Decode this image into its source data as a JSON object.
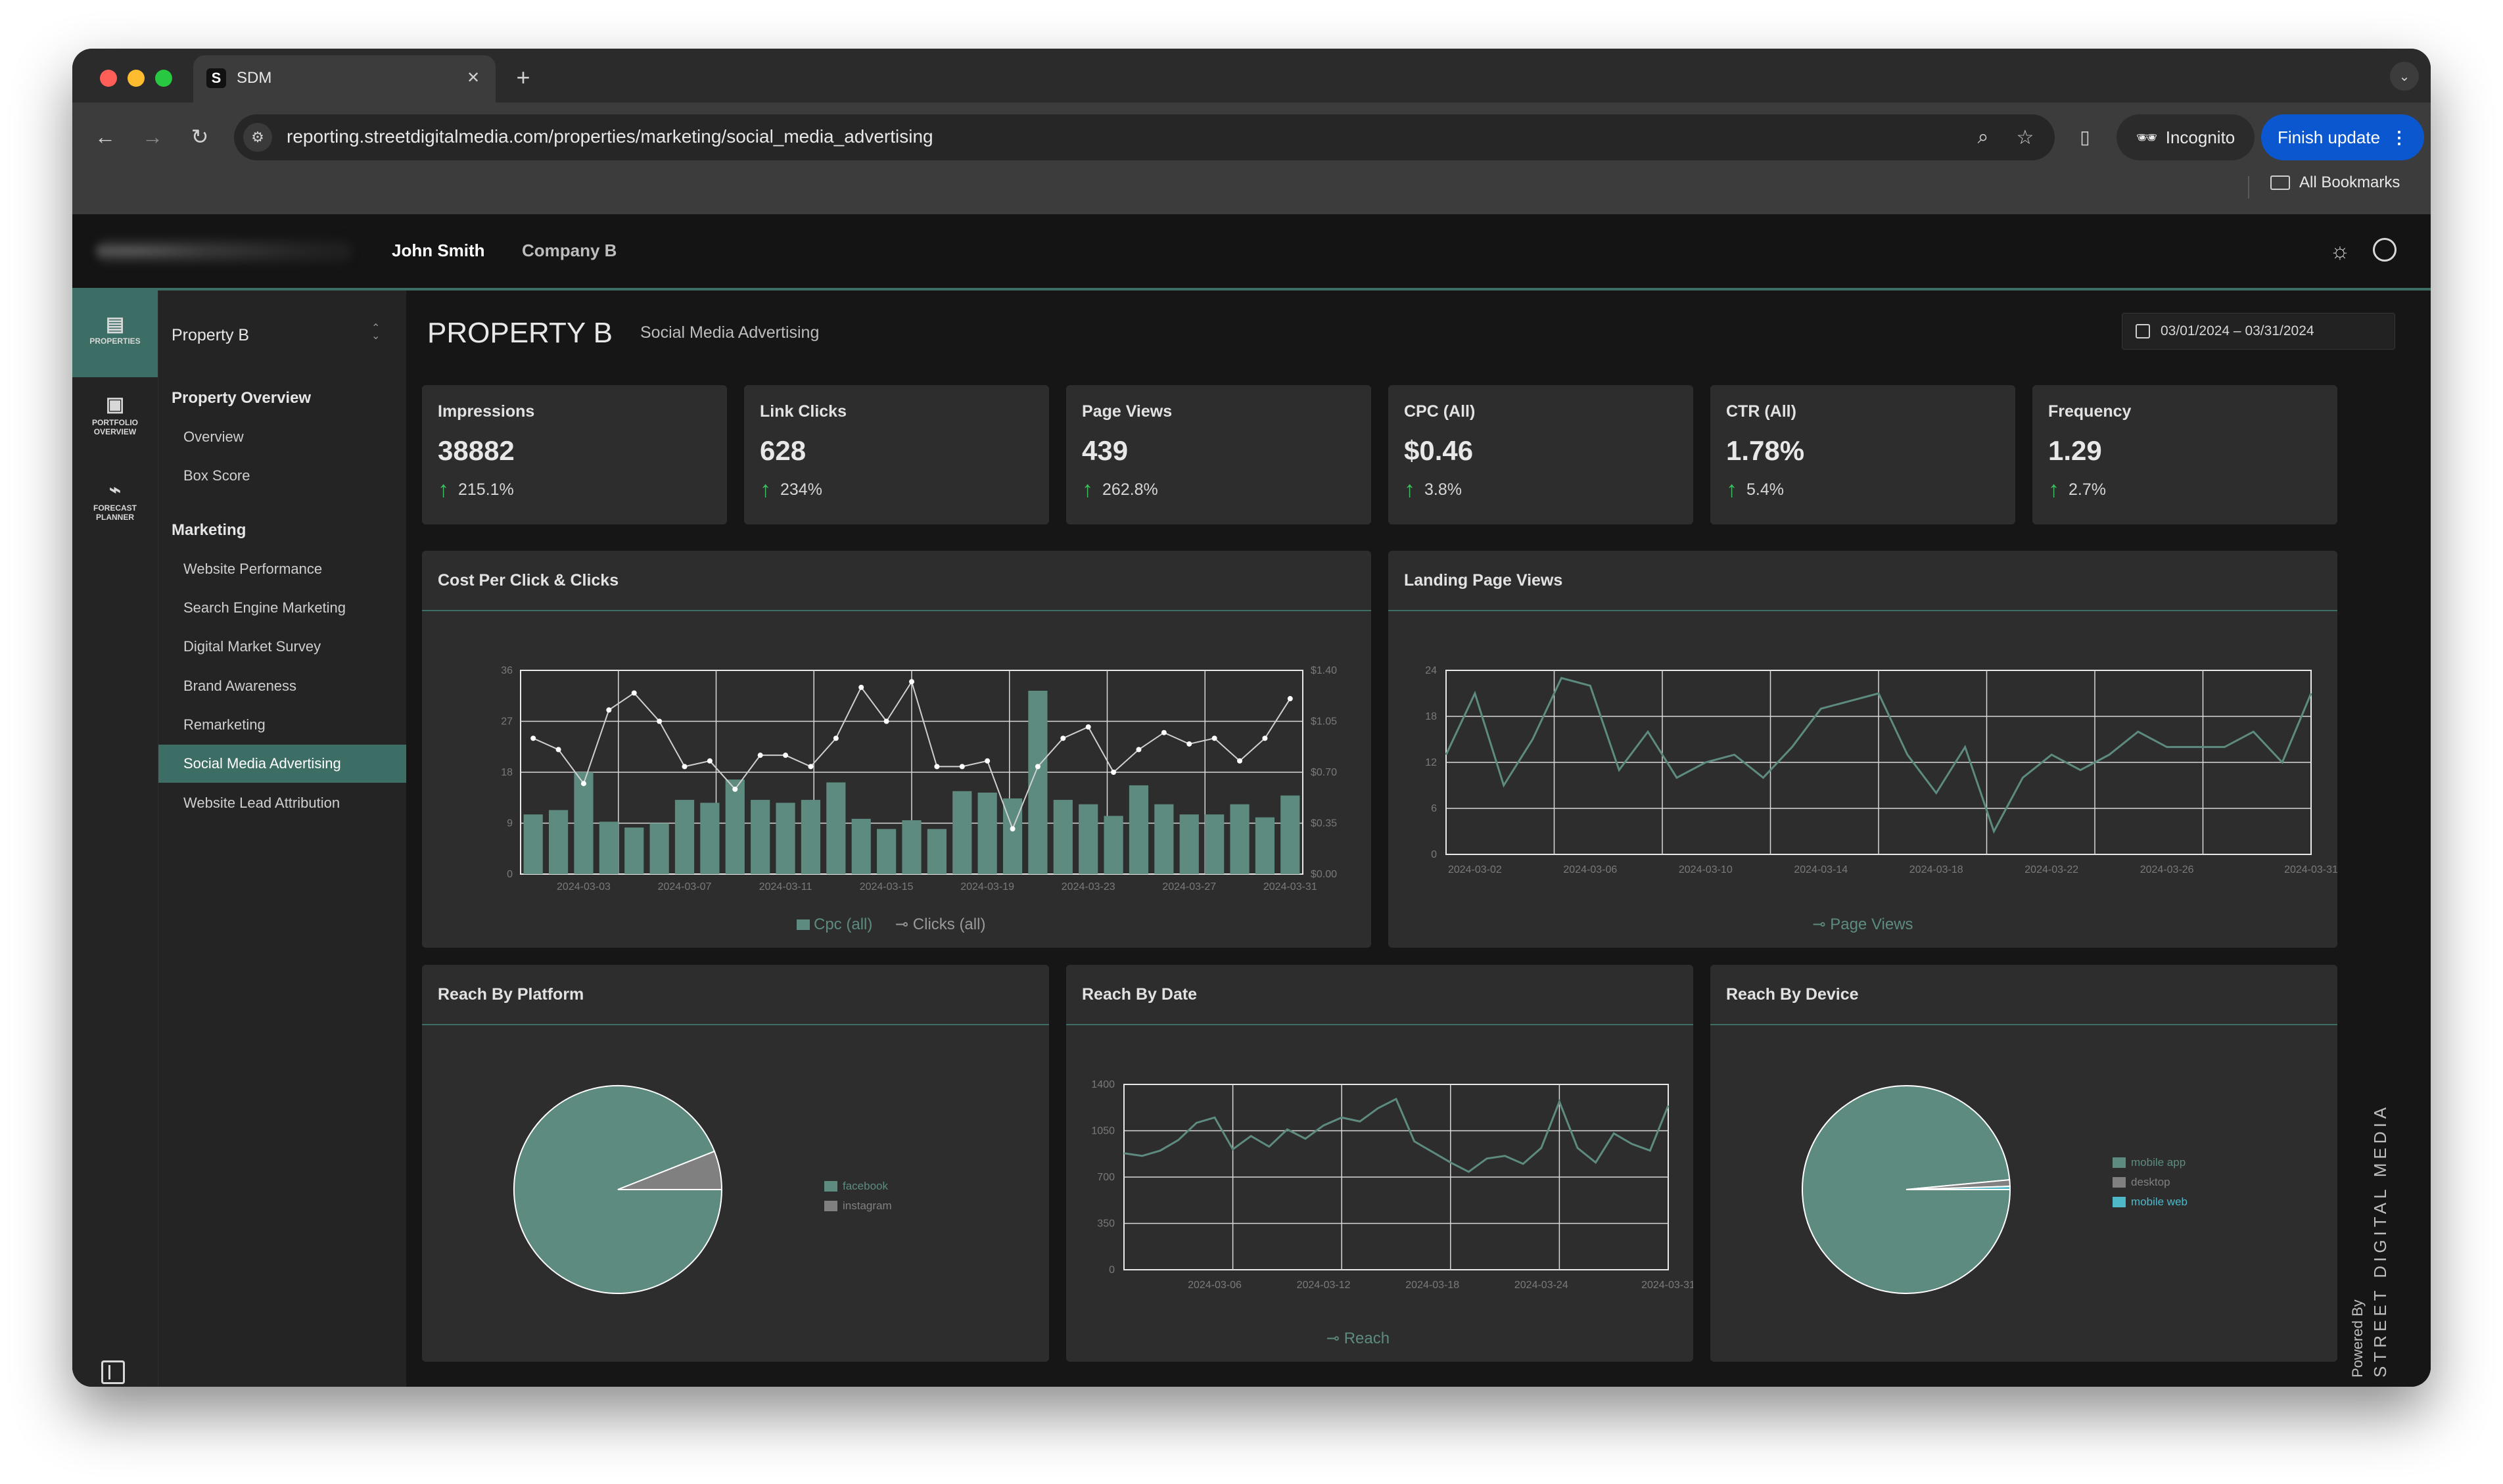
{
  "browser": {
    "tab_title": "SDM",
    "tab_favicon": "S",
    "url": "reporting.streetdigitalmedia.com/properties/marketing/social_media_advertising",
    "incognito_label": "Incognito",
    "finish_update_label": "Finish update",
    "bookmarks_label": "All Bookmarks"
  },
  "header": {
    "user_name": "John Smith",
    "company": "Company B"
  },
  "rail": {
    "items": [
      {
        "label1": "PROPERTIES",
        "label2": "",
        "icon": "building-icon"
      },
      {
        "label1": "PORTFOLIO",
        "label2": "OVERVIEW",
        "icon": "bookmark-icon"
      },
      {
        "label1": "FORECAST",
        "label2": "PLANNER",
        "icon": "chart-icon"
      }
    ]
  },
  "sidebar": {
    "property_select": "Property B",
    "section1": "Property Overview",
    "section1_items": [
      "Overview",
      "Box Score"
    ],
    "section2": "Marketing",
    "section2_items": [
      "Website Performance",
      "Search Engine Marketing",
      "Digital Market Survey",
      "Brand Awareness",
      "Remarketing",
      "Social Media Advertising",
      "Website Lead Attribution"
    ],
    "active_item": "Social Media Advertising"
  },
  "page": {
    "title": "PROPERTY B",
    "subtitle": "Social Media Advertising",
    "date_range": "03/01/2024 – 03/31/2024"
  },
  "kpis": [
    {
      "label": "Impressions",
      "value": "38882",
      "delta": "215.1%"
    },
    {
      "label": "Link Clicks",
      "value": "628",
      "delta": "234%"
    },
    {
      "label": "Page Views",
      "value": "439",
      "delta": "262.8%"
    },
    {
      "label": "CPC (All)",
      "value": "$0.46",
      "delta": "3.8%"
    },
    {
      "label": "CTR (All)",
      "value": "1.78%",
      "delta": "5.4%"
    },
    {
      "label": "Frequency",
      "value": "1.29",
      "delta": "2.7%"
    }
  ],
  "colors": {
    "accent": "#5e8b80",
    "delta_up": "#3fbf62",
    "pie_instagram": "#808080",
    "pie_mobile_web": "#4fb8c9"
  },
  "branding": {
    "powered_by": "Powered By",
    "brand": "STREET DIGITAL MEDIA"
  },
  "chart_data": [
    {
      "type": "bar",
      "title": "Cost Per Click & Clicks",
      "x": [
        "2024-03-01",
        "2024-03-02",
        "2024-03-03",
        "2024-03-04",
        "2024-03-05",
        "2024-03-06",
        "2024-03-07",
        "2024-03-08",
        "2024-03-09",
        "2024-03-10",
        "2024-03-11",
        "2024-03-12",
        "2024-03-13",
        "2024-03-14",
        "2024-03-15",
        "2024-03-16",
        "2024-03-17",
        "2024-03-18",
        "2024-03-19",
        "2024-03-20",
        "2024-03-21",
        "2024-03-22",
        "2024-03-23",
        "2024-03-24",
        "2024-03-25",
        "2024-03-26",
        "2024-03-27",
        "2024-03-28",
        "2024-03-29",
        "2024-03-30",
        "2024-03-31"
      ],
      "x_tick_labels": [
        "2024-03-03",
        "2024-03-07",
        "2024-03-11",
        "2024-03-15",
        "2024-03-19",
        "2024-03-23",
        "2024-03-27",
        "2024-03-31"
      ],
      "y_ticks": [
        "0",
        "9",
        "18",
        "27",
        "36"
      ],
      "y2_ticks": [
        "$0.00",
        "$0.35",
        "$0.70",
        "$1.05",
        "$1.40"
      ],
      "ylim": [
        0,
        36
      ],
      "y2lim": [
        0,
        1.4
      ],
      "series": [
        {
          "name": "Cpc (all)",
          "type": "bar",
          "axis": "right",
          "values": [
            0.41,
            0.44,
            0.7,
            0.36,
            0.32,
            0.35,
            0.51,
            0.49,
            0.65,
            0.51,
            0.49,
            0.51,
            0.63,
            0.38,
            0.31,
            0.37,
            0.31,
            0.57,
            0.56,
            0.52,
            1.26,
            0.51,
            0.48,
            0.4,
            0.61,
            0.48,
            0.41,
            0.41,
            0.48,
            0.39,
            0.54
          ]
        },
        {
          "name": "Clicks (all)",
          "type": "line",
          "axis": "left",
          "values": [
            24,
            22,
            16,
            29,
            32,
            27,
            19,
            20,
            15,
            21,
            21,
            19,
            24,
            33,
            27,
            34,
            19,
            19,
            20,
            8,
            19,
            24,
            26,
            18,
            22,
            25,
            23,
            24,
            20,
            24,
            31
          ]
        }
      ],
      "legend_position": "bottom"
    },
    {
      "type": "line",
      "title": "Landing Page Views",
      "x": [
        "2024-03-01",
        "2024-03-02",
        "2024-03-03",
        "2024-03-04",
        "2024-03-05",
        "2024-03-06",
        "2024-03-07",
        "2024-03-08",
        "2024-03-09",
        "2024-03-10",
        "2024-03-11",
        "2024-03-12",
        "2024-03-13",
        "2024-03-14",
        "2024-03-15",
        "2024-03-16",
        "2024-03-17",
        "2024-03-18",
        "2024-03-19",
        "2024-03-20",
        "2024-03-21",
        "2024-03-22",
        "2024-03-23",
        "2024-03-24",
        "2024-03-25",
        "2024-03-26",
        "2024-03-27",
        "2024-03-28",
        "2024-03-29",
        "2024-03-30",
        "2024-03-31"
      ],
      "x_tick_labels": [
        "2024-03-02",
        "2024-03-06",
        "2024-03-10",
        "2024-03-14",
        "2024-03-18",
        "2024-03-22",
        "2024-03-26",
        "2024-03-31"
      ],
      "y_ticks": [
        "0",
        "6",
        "12",
        "18",
        "24"
      ],
      "ylim": [
        0,
        24
      ],
      "series": [
        {
          "name": "Page Views",
          "values": [
            13,
            21,
            9,
            15,
            23,
            22,
            11,
            16,
            10,
            12,
            13,
            10,
            14,
            19,
            20,
            21,
            13,
            8,
            14,
            3,
            10,
            13,
            11,
            13,
            16,
            14,
            14,
            14,
            16,
            12,
            21
          ]
        }
      ],
      "legend_position": "bottom"
    },
    {
      "type": "pie",
      "title": "Reach By Platform",
      "labels": [
        "facebook",
        "instagram"
      ],
      "values": [
        94,
        6
      ],
      "legend_position": "right"
    },
    {
      "type": "line",
      "title": "Reach By Date",
      "x": [
        "2024-03-01",
        "2024-03-02",
        "2024-03-03",
        "2024-03-04",
        "2024-03-05",
        "2024-03-06",
        "2024-03-07",
        "2024-03-08",
        "2024-03-09",
        "2024-03-10",
        "2024-03-11",
        "2024-03-12",
        "2024-03-13",
        "2024-03-14",
        "2024-03-15",
        "2024-03-16",
        "2024-03-17",
        "2024-03-18",
        "2024-03-19",
        "2024-03-20",
        "2024-03-21",
        "2024-03-22",
        "2024-03-23",
        "2024-03-24",
        "2024-03-25",
        "2024-03-26",
        "2024-03-27",
        "2024-03-28",
        "2024-03-29",
        "2024-03-30",
        "2024-03-31"
      ],
      "x_tick_labels": [
        "2024-03-06",
        "2024-03-12",
        "2024-03-18",
        "2024-03-24",
        "2024-03-31"
      ],
      "y_ticks": [
        "0",
        "350",
        "700",
        "1050",
        "1400"
      ],
      "ylim": [
        0,
        1400
      ],
      "series": [
        {
          "name": "Reach",
          "values": [
            880,
            860,
            900,
            980,
            1110,
            1150,
            910,
            1010,
            930,
            1060,
            990,
            1090,
            1150,
            1120,
            1220,
            1290,
            970,
            890,
            810,
            740,
            840,
            860,
            800,
            920,
            1270,
            920,
            810,
            1030,
            950,
            900,
            1240
          ]
        }
      ],
      "legend_position": "bottom"
    },
    {
      "type": "pie",
      "title": "Reach By Device",
      "labels": [
        "mobile app",
        "desktop",
        "mobile web"
      ],
      "values": [
        98.5,
        1.0,
        0.5
      ],
      "legend_position": "right"
    }
  ]
}
